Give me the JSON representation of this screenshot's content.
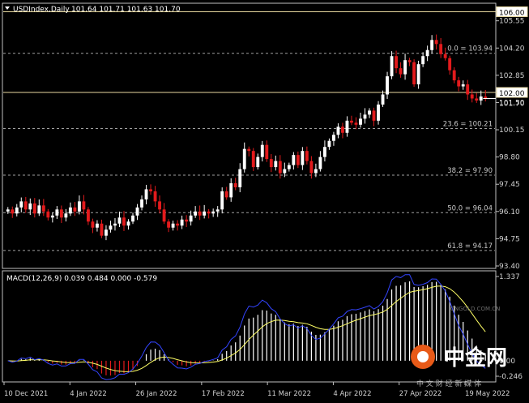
{
  "chart_data": [
    {
      "type": "candlestick",
      "symbol": "USDIndex,Daily",
      "ohlc_text": "101.64 101.71 101.63 101.70",
      "colors": {
        "up": "#ffffff",
        "down": "#e31a1c",
        "background": "#000000",
        "fib_line": "#a0a0a0",
        "hline": "#e8d9a0"
      },
      "price_axis": {
        "min": 93.4,
        "max": 106.3,
        "ticks": [
          "105.55",
          "104.20",
          "102.85",
          "101.50",
          "100.15",
          "98.80",
          "97.45",
          "96.10",
          "94.75",
          "93.40"
        ]
      },
      "date_labels": [
        "10 Dec 2021",
        "4 Jan 2022",
        "26 Jan 2022",
        "17 Feb 2022",
        "11 Mar 2022",
        "4 Apr 2022",
        "27 Apr 2022",
        "19 May 2022"
      ],
      "horizontal_levels": [
        {
          "value": 106.0,
          "label": "106.00"
        },
        {
          "value": 102.0,
          "label": "102.00"
        }
      ],
      "current_price_label": "101.70",
      "fibonacci": [
        {
          "label": "0.0 = 103.94",
          "value": 103.94
        },
        {
          "label": "23.6 = 100.21",
          "value": 100.21
        },
        {
          "label": "38.2 = 97.90",
          "value": 97.9
        },
        {
          "label": "50.0 = 96.04",
          "value": 96.04
        },
        {
          "label": "61.8 = 94.17",
          "value": 94.17
        }
      ],
      "closes": [
        96.2,
        96.0,
        96.3,
        96.6,
        96.2,
        96.5,
        96.0,
        96.4,
        96.1,
        95.8,
        95.9,
        96.2,
        95.8,
        96.0,
        96.3,
        96.1,
        96.6,
        96.2,
        95.6,
        95.3,
        95.5,
        94.9,
        95.2,
        95.4,
        95.5,
        95.8,
        95.4,
        95.6,
        95.9,
        96.3,
        96.7,
        97.2,
        97.1,
        96.6,
        96.2,
        95.6,
        95.3,
        95.5,
        95.4,
        95.7,
        95.6,
        95.9,
        96.1,
        95.9,
        96.1,
        96.0,
        96.1,
        96.2,
        97.1,
        96.8,
        97.5,
        97.3,
        98.2,
        99.2,
        99.1,
        98.3,
        98.8,
        99.4,
        98.7,
        98.3,
        98.6,
        98.0,
        98.2,
        98.4,
        98.9,
        98.4,
        99.1,
        98.6,
        98.0,
        98.2,
        98.8,
        99.3,
        99.6,
        99.9,
        100.3,
        100.0,
        100.6,
        100.5,
        100.4,
        100.7,
        100.9,
        101.1,
        100.6,
        101.4,
        101.9,
        102.8,
        103.8,
        103.2,
        102.9,
        103.6,
        103.5,
        102.4,
        103.4,
        103.8,
        104.1,
        104.6,
        104.4,
        103.9,
        103.7,
        103.1,
        102.6,
        102.3,
        102.4,
        101.9,
        101.7,
        101.6,
        101.8,
        101.7
      ],
      "macd": {
        "title": "MACD(12,26,9) 0.039 0.484 0.000 -0.579",
        "ticks": [
          "1.337",
          "0.00",
          "-0.246"
        ],
        "min": -0.246,
        "max": 1.337
      }
    }
  ],
  "watermark": {
    "brand": "中金网",
    "domain": "CNGOLD.COM.CN",
    "slogan": "中 文 财 经 新 媒 体"
  }
}
